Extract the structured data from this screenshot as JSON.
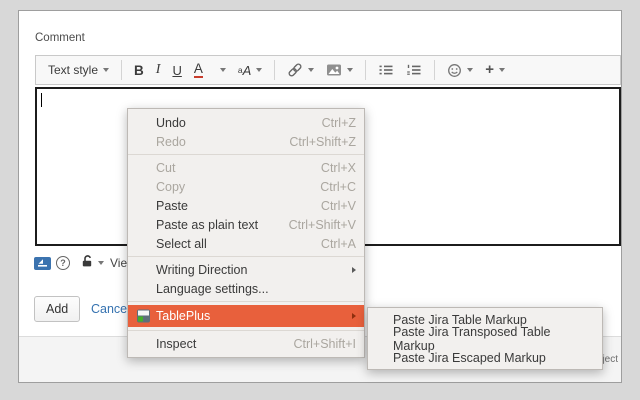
{
  "colors": {
    "accent": "#e8603c",
    "link": "#3572b0",
    "wiki_icon_blue": "#3b73af",
    "color_underline_red": "#c83c2c",
    "tableplus_green": "#43b02a"
  },
  "comment_form": {
    "label": "Comment",
    "toolbar": {
      "text_style": "Text style",
      "bold": "B",
      "italic": "I",
      "underline": "U",
      "text_color": "A",
      "font_style_small": "a",
      "font_style_big": "A",
      "plus": "+"
    },
    "editor": {
      "value": ""
    },
    "meta": {
      "help": "?",
      "visibility_label": "Viewa"
    },
    "actions": {
      "add": "Add",
      "cancel": "Cancel"
    },
    "footer": {
      "clipped_text": "ject"
    }
  },
  "context_menu": {
    "items": [
      {
        "label": "Undo",
        "shortcut": "Ctrl+Z"
      },
      {
        "label": "Redo",
        "shortcut": "Ctrl+Shift+Z",
        "disabled": true
      },
      {
        "separator": true
      },
      {
        "label": "Cut",
        "shortcut": "Ctrl+X",
        "disabled": true
      },
      {
        "label": "Copy",
        "shortcut": "Ctrl+C",
        "disabled": true
      },
      {
        "label": "Paste",
        "shortcut": "Ctrl+V"
      },
      {
        "label": "Paste as plain text",
        "shortcut": "Ctrl+Shift+V"
      },
      {
        "label": "Select all",
        "shortcut": "Ctrl+A"
      },
      {
        "separator": true
      },
      {
        "label": "Writing Direction",
        "submenu": true
      },
      {
        "label": "Language settings..."
      },
      {
        "separator": true
      },
      {
        "label": "TablePlus",
        "submenu": true,
        "highlighted": true,
        "icon": "tableplus-icon"
      },
      {
        "separator": true
      },
      {
        "label": "Inspect",
        "shortcut": "Ctrl+Shift+I"
      }
    ]
  },
  "submenu": {
    "items": [
      "Paste Jira Table Markup",
      "Paste Jira Transposed Table Markup",
      "Paste Jira Escaped Markup"
    ]
  }
}
